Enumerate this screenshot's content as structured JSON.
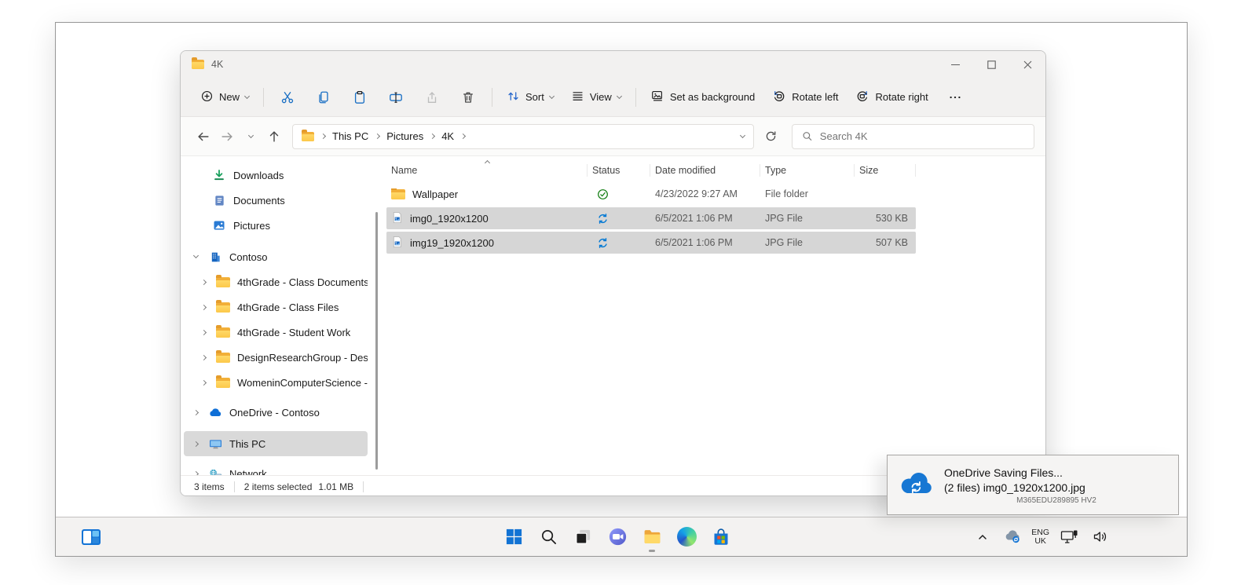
{
  "window": {
    "title": "4K"
  },
  "toolbar": {
    "new": "New",
    "sort": "Sort",
    "view": "View",
    "set_background": "Set as background",
    "rotate_left": "Rotate left",
    "rotate_right": "Rotate right"
  },
  "address": {
    "crumbs": [
      "This PC",
      "Pictures",
      "4K"
    ],
    "search_placeholder": "Search 4K"
  },
  "sidebar": {
    "items": [
      {
        "label": "Downloads",
        "icon": "downloads-icon"
      },
      {
        "label": "Documents",
        "icon": "document-icon"
      },
      {
        "label": "Pictures",
        "icon": "pictures-icon"
      },
      {
        "label": "Contoso",
        "icon": "building-icon"
      },
      {
        "label": "4thGrade - Class Documents",
        "icon": "folder-icon"
      },
      {
        "label": "4thGrade - Class Files",
        "icon": "folder-icon"
      },
      {
        "label": "4thGrade - Student Work",
        "icon": "folder-icon"
      },
      {
        "label": "DesignResearchGroup - Design Re",
        "icon": "folder-icon"
      },
      {
        "label": "WomeninComputerScience - Man",
        "icon": "folder-icon"
      },
      {
        "label": "OneDrive - Contoso",
        "icon": "onedrive-icon"
      },
      {
        "label": "This PC",
        "icon": "this-pc-icon",
        "selected": true
      },
      {
        "label": "Network",
        "icon": "network-icon"
      }
    ]
  },
  "files": {
    "columns": [
      "Name",
      "Status",
      "Date modified",
      "Type",
      "Size"
    ],
    "rows": [
      {
        "name": "Wallpaper",
        "status": "synced",
        "date": "4/23/2022 9:27 AM",
        "type": "File folder",
        "size": "",
        "selected": false
      },
      {
        "name": "img0_1920x1200",
        "status": "syncing",
        "date": "6/5/2021 1:06 PM",
        "type": "JPG File",
        "size": "530 KB",
        "selected": true
      },
      {
        "name": "img19_1920x1200",
        "status": "syncing",
        "date": "6/5/2021 1:06 PM",
        "type": "JPG File",
        "size": "507 KB",
        "selected": true
      }
    ]
  },
  "statusbar": {
    "count": "3 items",
    "selected": "2 items selected",
    "size": "1.01 MB"
  },
  "toast": {
    "title": "OneDrive Saving Files...",
    "detail": "(2 files) img0_1920x1200.jpg",
    "code": "M365EDU289895 HV2"
  },
  "tray": {
    "lang": "ENG",
    "region": "UK"
  },
  "colors": {
    "accent_blue": "#0b70c4",
    "sync_blue": "#0078d4",
    "check_green": "#107c10",
    "folder_yellow": "#fcc84a",
    "selection_gray": "#d6d6d6"
  }
}
